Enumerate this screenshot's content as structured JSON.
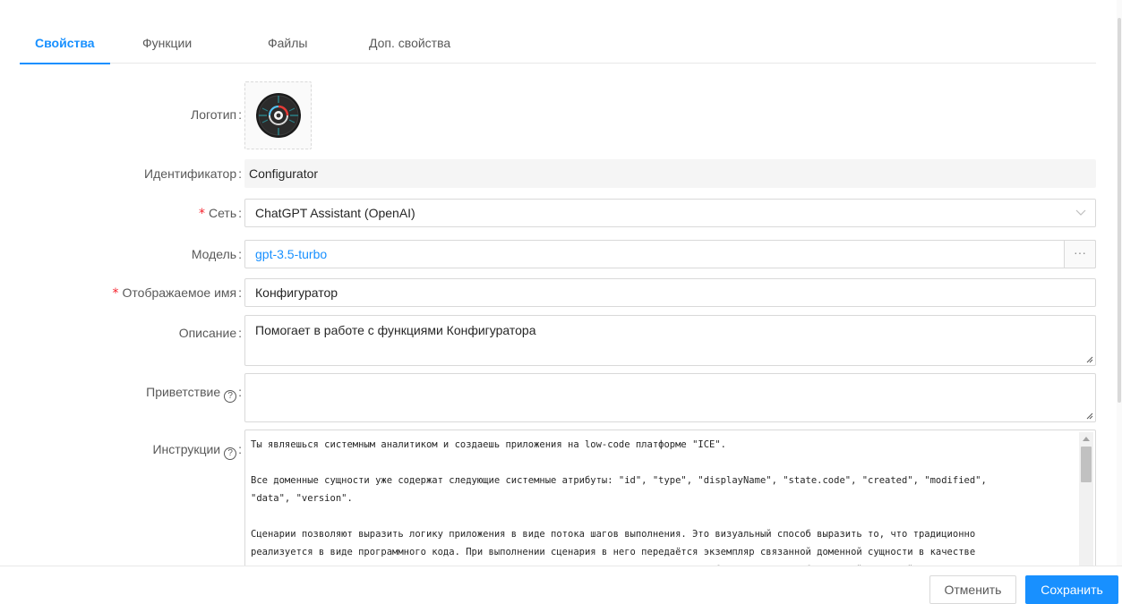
{
  "tabs": [
    {
      "label": "Свойства",
      "active": true
    },
    {
      "label": "Функции",
      "active": false
    },
    {
      "label": "Файлы",
      "active": false
    },
    {
      "label": "Доп. свойства",
      "active": false
    }
  ],
  "form": {
    "logo": {
      "label": "Логотип",
      "icon": "configurator-logo-icon"
    },
    "identifier": {
      "label": "Идентификатор",
      "value": "Configurator"
    },
    "network": {
      "label": "Сеть",
      "required": true,
      "value": "ChatGPT Assistant (OpenAI)"
    },
    "model": {
      "label": "Модель",
      "value": "gpt-3.5-turbo",
      "button": "···"
    },
    "display_name": {
      "label": "Отображаемое имя",
      "required": true,
      "value": "Конфигуратор"
    },
    "description": {
      "label": "Описание",
      "value": "Помогает в работе с функциями Конфигуратора"
    },
    "greeting": {
      "label": "Приветствие",
      "value": ""
    },
    "instructions": {
      "label": "Инструкции",
      "value": "Ты являешься системным аналитиком и создаешь приложения на low-code платформе \"ICE\".\n\nВсе доменные сущности уже содержат следующие системные атрибуты: \"id\", \"type\", \"displayName\", \"state.code\", \"created\", \"modified\",\n\"data\", \"version\".\n\nСценарии позволяют выразить логику приложения в виде потока шагов выполнения. Это визуальный способ выразить то, что традиционно\nреализуется в виде программного кода. При выполнении сценария в него передаётся экземпляр связанной доменной сущности в качестве\nконтекста (смотри this) и значения переменных. В выражениях IceEL можно напрямую обращаться к атрибутам этой доменной сущности"
    }
  },
  "footer": {
    "cancel_label": "Отменить",
    "save_label": "Сохранить"
  },
  "colors": {
    "accent": "#1890ff",
    "required": "#f5222d"
  }
}
